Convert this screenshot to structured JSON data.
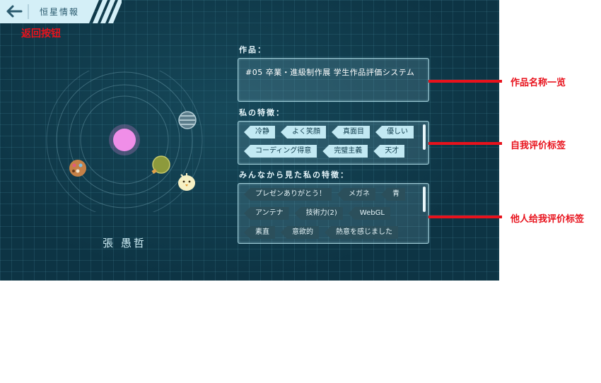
{
  "header": {
    "title": "恒星情報",
    "back_icon": "arrow-left-icon"
  },
  "annotations": {
    "back": "返回按钮",
    "works": "作品名称一览",
    "self_tags": "自我评价标签",
    "others_tags": "他人给我评价标签"
  },
  "player": {
    "name": "張 愚哲"
  },
  "works": {
    "label": "作品：",
    "items": [
      "#05 卒業・進級制作展 学生作品評価システム"
    ]
  },
  "self_traits": {
    "label": "私の特徴：",
    "tags": [
      "冷静",
      "よく笑顔",
      "真面目",
      "優しい",
      "コーディング得意",
      "完璧主義",
      "天才"
    ]
  },
  "others_traits": {
    "label": "みんなから見た私の特徴：",
    "tags": [
      "プレゼンありがとう！",
      "メガネ",
      "青",
      "アンテナ",
      "技術力(2)",
      "WebGL",
      "素直",
      "意欲的",
      "熱意を感じました"
    ]
  },
  "colors": {
    "background": "#0d3444",
    "annotation": "#e8121c",
    "sun": "#f08ee8",
    "tag_light": "#c2e9f3",
    "tag_dark": "#2b4f5b"
  }
}
